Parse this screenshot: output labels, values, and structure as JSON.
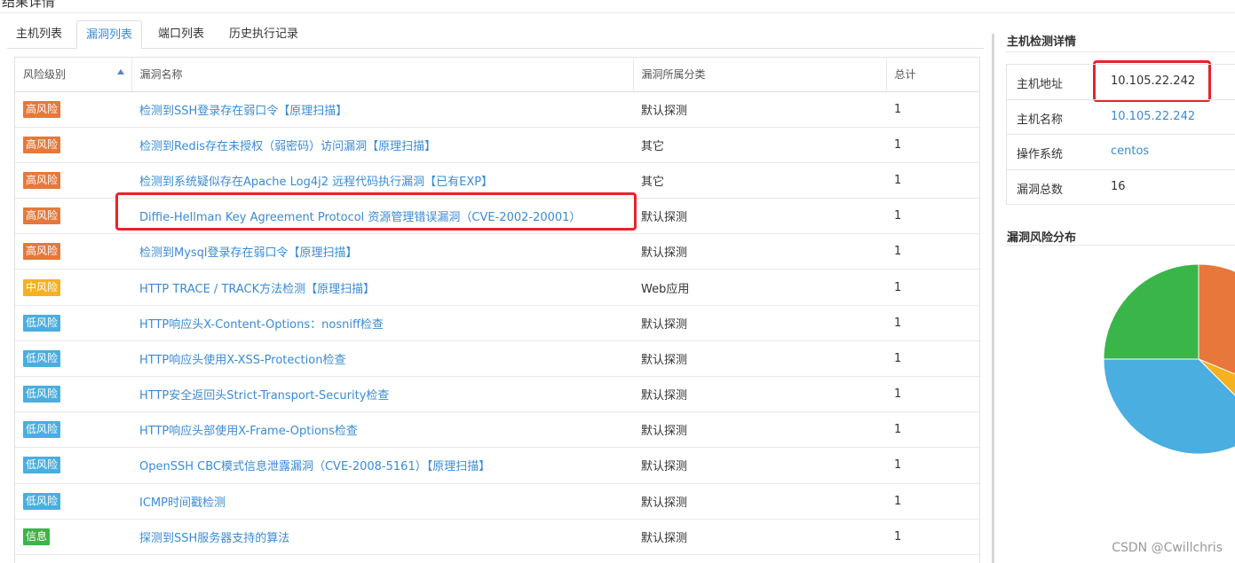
{
  "page": {
    "title": "结果详情"
  },
  "tabs": [
    {
      "label": "主机列表",
      "active": false
    },
    {
      "label": "漏洞列表",
      "active": true
    },
    {
      "label": "端口列表",
      "active": false
    },
    {
      "label": "历史执行记录",
      "active": false
    }
  ],
  "vuln_table": {
    "headers": [
      "风险级别",
      "漏洞名称",
      "漏洞所属分类",
      "总计"
    ],
    "rows": [
      {
        "level": "高风险",
        "level_color": "#e7773a",
        "name": "检测到SSH登录存在弱口令【原理扫描】",
        "category": "默认探测",
        "total": "1"
      },
      {
        "level": "高风险",
        "level_color": "#e7773a",
        "name": "检测到Redis存在未授权（弱密码）访问漏洞【原理扫描】",
        "category": "其它",
        "total": "1"
      },
      {
        "level": "高风险",
        "level_color": "#e7773a",
        "name": "检测到系统疑似存在Apache Log4j2 远程代码执行漏洞【已有EXP】",
        "category": "其它",
        "total": "1"
      },
      {
        "level": "高风险",
        "level_color": "#e7773a",
        "name": "Diffie-Hellman Key Agreement Protocol 资源管理错误漏洞（CVE-2002-20001）",
        "category": "默认探测",
        "total": "1"
      },
      {
        "level": "高风险",
        "level_color": "#e7773a",
        "name": "检测到Mysql登录存在弱口令【原理扫描】",
        "category": "默认探测",
        "total": "1"
      },
      {
        "level": "中风险",
        "level_color": "#f5b120",
        "name": "HTTP TRACE / TRACK方法检测【原理扫描】",
        "category": "Web应用",
        "total": "1"
      },
      {
        "level": "低风险",
        "level_color": "#4aaee0",
        "name": "HTTP响应头X-Content-Options：nosniff检查",
        "category": "默认探测",
        "total": "1"
      },
      {
        "level": "低风险",
        "level_color": "#4aaee0",
        "name": "HTTP响应头使用X-XSS-Protection检查",
        "category": "默认探测",
        "total": "1"
      },
      {
        "level": "低风险",
        "level_color": "#4aaee0",
        "name": "HTTP安全返回头Strict-Transport-Security检查",
        "category": "默认探测",
        "total": "1"
      },
      {
        "level": "低风险",
        "level_color": "#4aaee0",
        "name": "HTTP响应头部使用X-Frame-Options检查",
        "category": "默认探测",
        "total": "1"
      },
      {
        "level": "低风险",
        "level_color": "#4aaee0",
        "name": "OpenSSH CBC模式信息泄露漏洞（CVE-2008-5161）【原理扫描】",
        "category": "默认探测",
        "total": "1"
      },
      {
        "level": "低风险",
        "level_color": "#4aaee0",
        "name": "ICMP时间戳检测",
        "category": "默认探测",
        "total": "1"
      },
      {
        "level": "信息",
        "level_color": "#3ab54a",
        "name": "探测到SSH服务器支持的算法",
        "category": "默认探测",
        "total": "1"
      },
      {
        "level": "",
        "level_color": "#ffffff",
        "name": "",
        "category": "",
        "total": ""
      }
    ]
  },
  "host_detail": {
    "title": "主机检测详情",
    "rows": [
      {
        "label": "主机地址",
        "value": "10.105.22.242",
        "link": false
      },
      {
        "label": "主机名称",
        "value": "10.105.22.242",
        "link": true
      },
      {
        "label": "操作系统",
        "value": "centos",
        "link": true
      },
      {
        "label": "漏洞总数",
        "value": "16",
        "link": false
      }
    ]
  },
  "risk_distribution": {
    "title": "漏洞风险分布"
  },
  "chart_data": {
    "type": "pie",
    "title": "漏洞风险分布",
    "slices": [
      {
        "label": "高风险",
        "value": 5,
        "color": "#e7773a"
      },
      {
        "label": "中风险",
        "value": 1,
        "color": "#f5b120"
      },
      {
        "label": "低风险",
        "value": 6,
        "color": "#4aaee0"
      },
      {
        "label": "信息",
        "value": 4,
        "color": "#3ab54a"
      }
    ]
  },
  "watermark": "CSDN @Cwillchris"
}
